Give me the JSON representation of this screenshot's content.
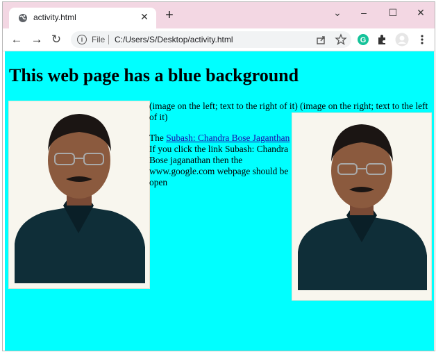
{
  "browser": {
    "tab_title": "activity.html",
    "tab_close": "✕",
    "new_tab": "+",
    "window_controls": {
      "minimize": "–",
      "maximize": "☐",
      "close": "✕",
      "chevron": "⌄"
    },
    "nav": {
      "back": "←",
      "forward": "→",
      "reload": "↻"
    },
    "omnibox": {
      "info": "i",
      "scheme_label": "File",
      "url": "C:/Users/S/Desktop/activity.html"
    }
  },
  "page": {
    "heading": "This web page has a blue background",
    "caption": "(image on the left; text to the right of it) (image on the right; text to the left of it)",
    "para_prefix": "The",
    "link_text": "Subash: Chandra Bose Jaganthan",
    "para_suffix": "If you click the link Subash: Chandra Bose jaganathan then the www.google.com webpage should be open",
    "background_color": "#00ffff"
  },
  "icons": {
    "globe": "globe-icon",
    "share": "share-icon",
    "star": "star-icon",
    "grammarly": "grammarly-icon",
    "extensions": "puzzle-icon",
    "profile": "profile-icon",
    "menu": "kebab-menu-icon"
  }
}
